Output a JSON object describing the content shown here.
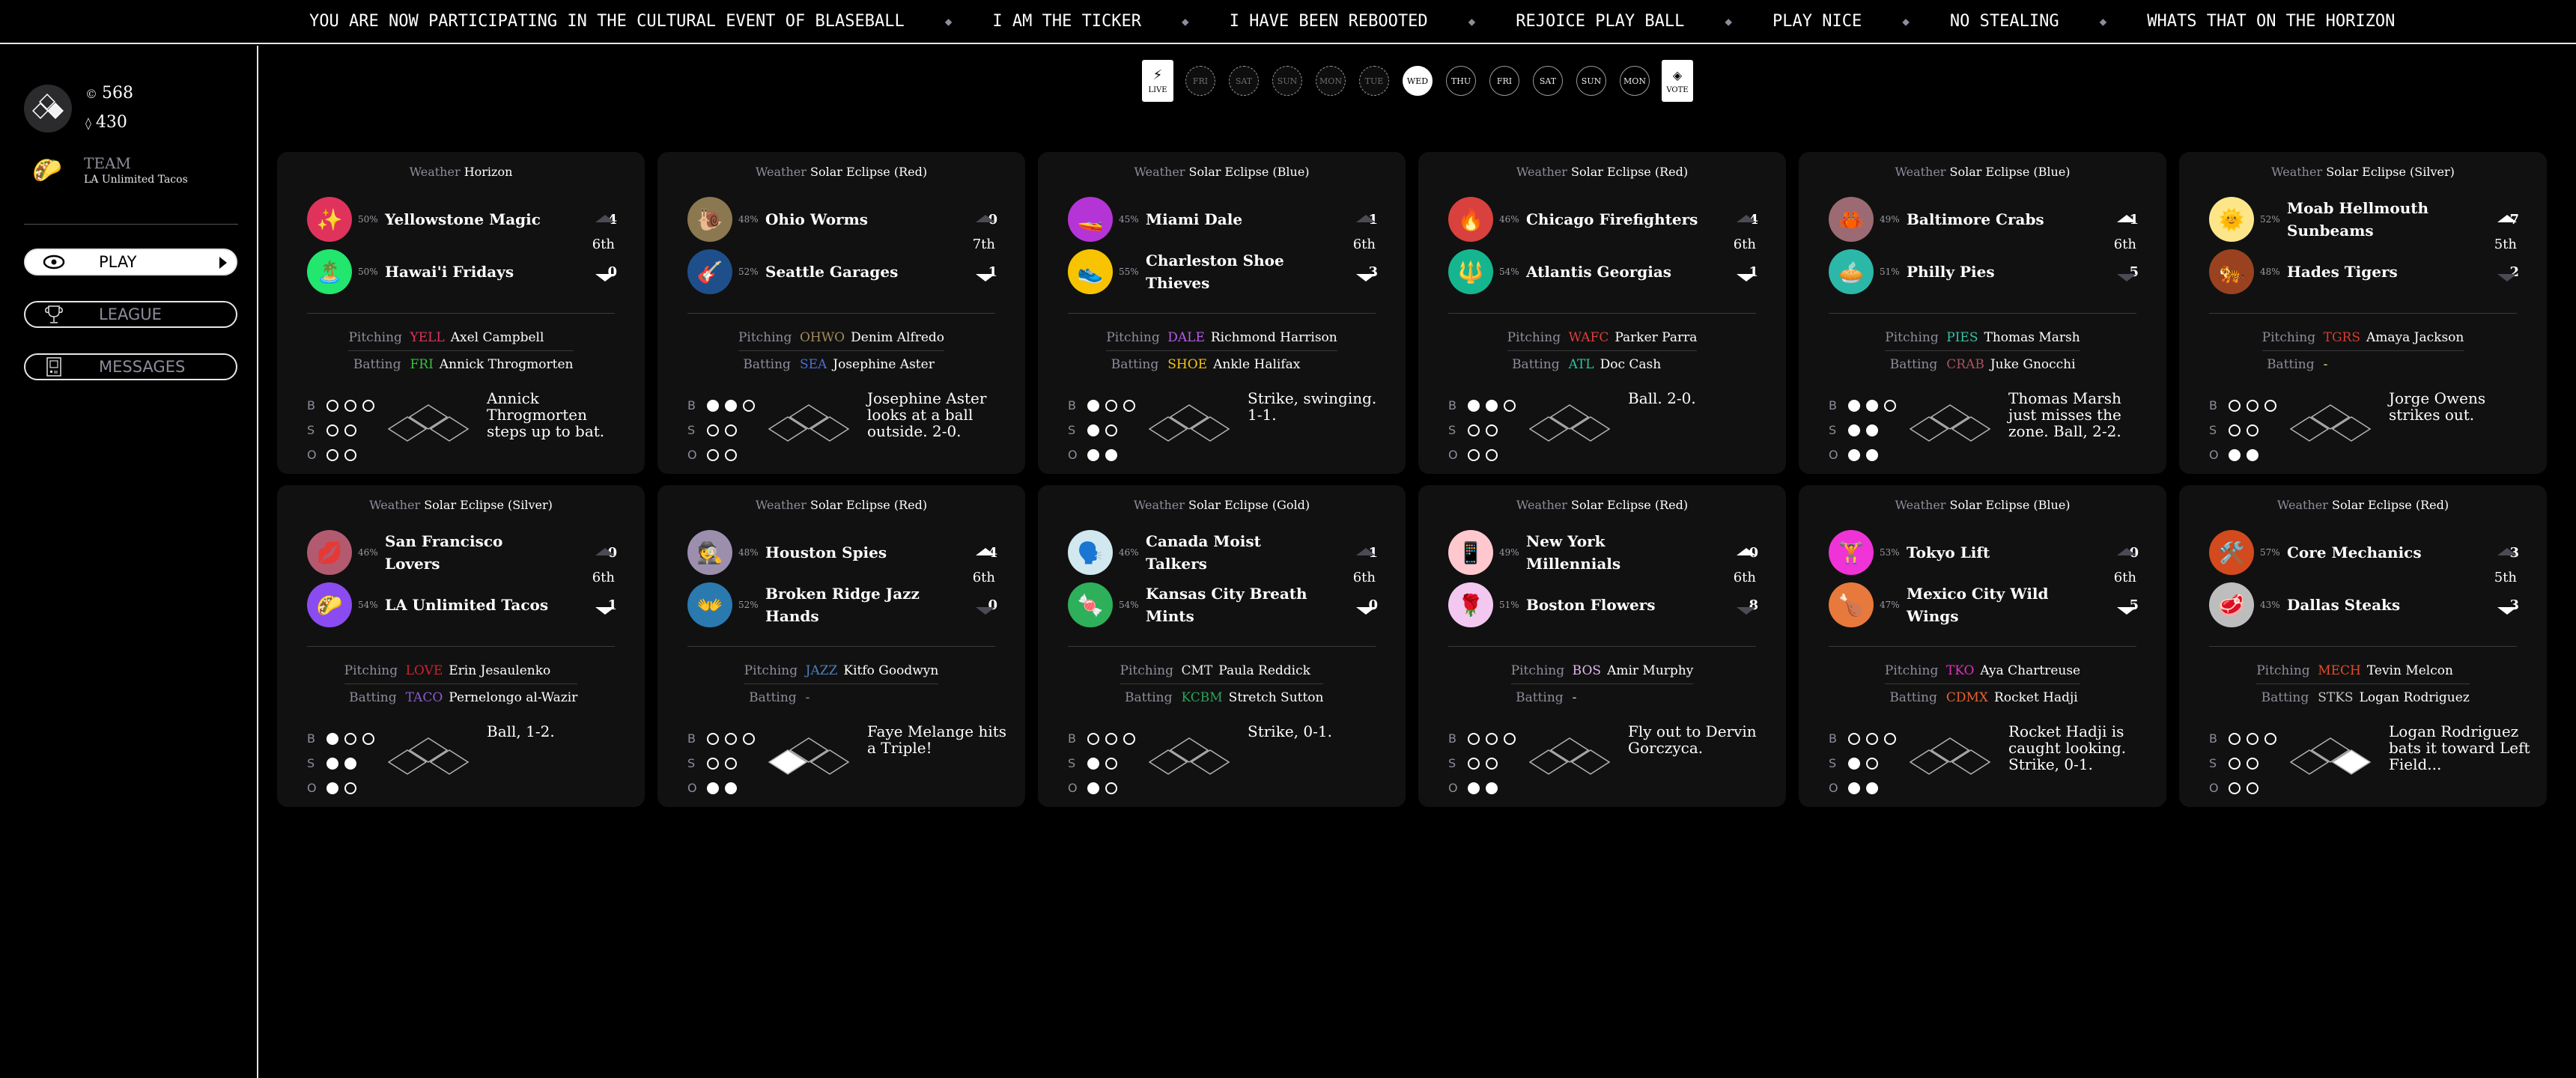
{
  "ticker": {
    "messages": [
      "YOU ARE NOW PARTICIPATING IN THE CULTURAL EVENT OF BLASEBALL",
      "I AM THE TICKER",
      "I HAVE BEEN REBOOTED",
      "REJOICE PLAY BALL",
      "PLAY NICE",
      "NO STEALING",
      "WHATS THAT ON THE HORIZON"
    ],
    "separator_icon": "diamond-icon"
  },
  "sidebar": {
    "coins": "568",
    "votes": "430",
    "coin_icon": "coin-icon",
    "vote_icon": "diamond-vote-icon",
    "team_label": "TEAM",
    "team_name": "LA Unlimited Tacos",
    "team_emoji": "🌮",
    "nav": [
      {
        "label": "PLAY",
        "icon": "eye-icon",
        "active": true
      },
      {
        "label": "LEAGUE",
        "icon": "trophy-icon",
        "active": false
      },
      {
        "label": "MESSAGES",
        "icon": "messages-icon",
        "active": false
      }
    ]
  },
  "day_selector": {
    "live_label": "LIVE",
    "vote_label": "VOTE",
    "days": [
      {
        "label": "FRI",
        "state": "past"
      },
      {
        "label": "SAT",
        "state": "past"
      },
      {
        "label": "SUN",
        "state": "past"
      },
      {
        "label": "MON",
        "state": "past"
      },
      {
        "label": "TUE",
        "state": "past"
      },
      {
        "label": "WED",
        "state": "current"
      },
      {
        "label": "THU",
        "state": "future"
      },
      {
        "label": "FRI",
        "state": "future"
      },
      {
        "label": "SAT",
        "state": "future"
      },
      {
        "label": "SUN",
        "state": "future"
      },
      {
        "label": "MON",
        "state": "future"
      }
    ]
  },
  "labels": {
    "weather": "Weather",
    "pitching": "Pitching",
    "batting": "Batting"
  },
  "games": [
    {
      "weather": "Horizon",
      "inning": "6th",
      "top_of_inning": false,
      "away": {
        "name": "Yellowstone Magic",
        "pct": "50%",
        "score": "4",
        "emoji": "✨",
        "color": "#e0335c"
      },
      "home": {
        "name": "Hawai'i Fridays",
        "pct": "50%",
        "score": "0",
        "emoji": "🏝️",
        "color": "#22e66d"
      },
      "pitching": {
        "abbr": "YELL",
        "abbr_color": "#e0335c",
        "name": "Axel Campbell"
      },
      "batting": {
        "abbr": "FRI",
        "abbr_color": "#35c43e",
        "name": "Annick Throgmorten"
      },
      "balls": 0,
      "strikes": 0,
      "outs": 0,
      "bases": [
        false,
        false,
        false
      ],
      "update": "Annick Throgmorten steps up to bat."
    },
    {
      "weather": "Solar Eclipse (Red)",
      "inning": "7th",
      "top_of_inning": false,
      "away": {
        "name": "Ohio Worms",
        "pct": "48%",
        "score": "0",
        "emoji": "🐌",
        "color": "#8b7850"
      },
      "home": {
        "name": "Seattle Garages",
        "pct": "52%",
        "score": "1",
        "emoji": "🎸",
        "color": "#1f4f8b"
      },
      "pitching": {
        "abbr": "OHWO",
        "abbr_color": "#a08a5a",
        "name": "Denim Alfredo"
      },
      "batting": {
        "abbr": "SEA",
        "abbr_color": "#4d6fd6",
        "name": "Josephine Aster"
      },
      "balls": 2,
      "strikes": 0,
      "outs": 0,
      "bases": [
        false,
        false,
        false
      ],
      "update": "Josephine Aster looks at a ball outside. 2-0."
    },
    {
      "weather": "Solar Eclipse (Blue)",
      "inning": "6th",
      "top_of_inning": false,
      "away": {
        "name": "Miami Dale",
        "pct": "45%",
        "score": "1",
        "emoji": "🚤",
        "color": "#b534d6"
      },
      "home": {
        "name": "Charleston Shoe Thieves",
        "pct": "55%",
        "score": "3",
        "emoji": "👟",
        "color": "#f8c300"
      },
      "pitching": {
        "abbr": "DALE",
        "abbr_color": "#b55be8",
        "name": "Richmond Harrison"
      },
      "batting": {
        "abbr": "SHOE",
        "abbr_color": "#f5c518",
        "name": "Ankle Halifax"
      },
      "balls": 1,
      "strikes": 1,
      "outs": 2,
      "bases": [
        false,
        false,
        false
      ],
      "update": "Strike, swinging. 1-1."
    },
    {
      "weather": "Solar Eclipse (Red)",
      "inning": "6th",
      "top_of_inning": false,
      "away": {
        "name": "Chicago Firefighters",
        "pct": "46%",
        "score": "4",
        "emoji": "🔥",
        "color": "#d8413d"
      },
      "home": {
        "name": "Atlantis Georgias",
        "pct": "54%",
        "score": "1",
        "emoji": "🔱",
        "color": "#15b68f"
      },
      "pitching": {
        "abbr": "WAFC",
        "abbr_color": "#d8413d",
        "name": "Parker Parra"
      },
      "batting": {
        "abbr": "ATL",
        "abbr_color": "#2dc4a0",
        "name": "Doc Cash"
      },
      "balls": 2,
      "strikes": 0,
      "outs": 0,
      "bases": [
        false,
        false,
        false
      ],
      "update": "Ball. 2-0."
    },
    {
      "weather": "Solar Eclipse (Blue)",
      "inning": "6th",
      "top_of_inning": true,
      "away": {
        "name": "Baltimore Crabs",
        "pct": "49%",
        "score": "1",
        "emoji": "🦀",
        "color": "#9b6a72"
      },
      "home": {
        "name": "Philly Pies",
        "pct": "51%",
        "score": "5",
        "emoji": "🥧",
        "color": "#2cb8a8"
      },
      "pitching": {
        "abbr": "PIES",
        "abbr_color": "#39c2a6",
        "name": "Thomas Marsh"
      },
      "batting": {
        "abbr": "CRAB",
        "abbr_color": "#a8535f",
        "name": "Juke Gnocchi"
      },
      "balls": 2,
      "strikes": 2,
      "outs": 2,
      "bases": [
        false,
        false,
        false
      ],
      "update": "Thomas Marsh just misses the zone. Ball, 2-2."
    },
    {
      "weather": "Solar Eclipse (Silver)",
      "inning": "5th",
      "top_of_inning": true,
      "away": {
        "name": "Moab Hellmouth Sunbeams",
        "pct": "52%",
        "score": "7",
        "emoji": "🌞",
        "color": "#fde68a"
      },
      "home": {
        "name": "Hades Tigers",
        "pct": "48%",
        "score": "2",
        "emoji": "🐅",
        "color": "#9a4220"
      },
      "pitching": {
        "abbr": "TGRS",
        "abbr_color": "#d83b32",
        "name": "Amaya Jackson"
      },
      "batting": {
        "abbr": "-",
        "abbr_color": "#f5e28a",
        "name": ""
      },
      "balls": 0,
      "strikes": 0,
      "outs": 2,
      "bases": [
        false,
        false,
        false
      ],
      "update": "Jorge Owens strikes out."
    },
    {
      "weather": "Solar Eclipse (Silver)",
      "inning": "6th",
      "top_of_inning": false,
      "away": {
        "name": "San Francisco Lovers",
        "pct": "46%",
        "score": "0",
        "emoji": "💋",
        "color": "#b25a70"
      },
      "home": {
        "name": "LA Unlimited Tacos",
        "pct": "54%",
        "score": "1",
        "emoji": "🌮",
        "color": "#8a4cf0"
      },
      "pitching": {
        "abbr": "LOVE",
        "abbr_color": "#d1202f",
        "name": "Erin Jesaulenko"
      },
      "batting": {
        "abbr": "TACO",
        "abbr_color": "#8a5cc8",
        "name": "Pernelongo al-Wazir"
      },
      "balls": 1,
      "strikes": 2,
      "outs": 1,
      "bases": [
        false,
        false,
        false
      ],
      "update": "Ball, 1-2."
    },
    {
      "weather": "Solar Eclipse (Red)",
      "inning": "6th",
      "top_of_inning": true,
      "away": {
        "name": "Houston Spies",
        "pct": "48%",
        "score": "4",
        "emoji": "🕵️",
        "color": "#9c8fae"
      },
      "home": {
        "name": "Broken Ridge Jazz Hands",
        "pct": "52%",
        "score": "0",
        "emoji": "👐",
        "color": "#2a7ab0"
      },
      "pitching": {
        "abbr": "JAZZ",
        "abbr_color": "#4c7fc4",
        "name": "Kitfo Goodwyn"
      },
      "batting": {
        "abbr": "-",
        "abbr_color": "#9a9aa5",
        "name": ""
      },
      "balls": 0,
      "strikes": 0,
      "outs": 2,
      "bases": [
        false,
        false,
        true
      ],
      "update": "Faye Melange hits a Triple!"
    },
    {
      "weather": "Solar Eclipse (Gold)",
      "inning": "6th",
      "top_of_inning": false,
      "away": {
        "name": "Canada Moist Talkers",
        "pct": "46%",
        "score": "1",
        "emoji": "🗣️",
        "color": "#d1e8f0"
      },
      "home": {
        "name": "Kansas City Breath Mints",
        "pct": "54%",
        "score": "0",
        "emoji": "🍬",
        "color": "#2eaf5a"
      },
      "pitching": {
        "abbr": "CMT",
        "abbr_color": "#e6e6e6",
        "name": "Paula Reddick"
      },
      "batting": {
        "abbr": "KCBM",
        "abbr_color": "#2ea25a",
        "name": "Stretch Sutton"
      },
      "balls": 0,
      "strikes": 1,
      "outs": 1,
      "bases": [
        false,
        false,
        false
      ],
      "update": "Strike, 0-1."
    },
    {
      "weather": "Solar Eclipse (Red)",
      "inning": "6th",
      "top_of_inning": true,
      "away": {
        "name": "New York Millennials",
        "pct": "49%",
        "score": "0",
        "emoji": "📱",
        "color": "#ffc8cf"
      },
      "home": {
        "name": "Boston Flowers",
        "pct": "51%",
        "score": "8",
        "emoji": "🌹",
        "color": "#f2c8f0"
      },
      "pitching": {
        "abbr": "BOS",
        "abbr_color": "#e3b8f0",
        "name": "Amir Murphy"
      },
      "batting": {
        "abbr": "-",
        "abbr_color": "#ffc8cf",
        "name": ""
      },
      "balls": 0,
      "strikes": 0,
      "outs": 2,
      "bases": [
        false,
        false,
        false
      ],
      "update": "Fly out to Dervin Gorczyca."
    },
    {
      "weather": "Solar Eclipse (Blue)",
      "inning": "6th",
      "top_of_inning": false,
      "away": {
        "name": "Tokyo Lift",
        "pct": "53%",
        "score": "0",
        "emoji": "🏋️",
        "color": "#f033d6"
      },
      "home": {
        "name": "Mexico City Wild Wings",
        "pct": "47%",
        "score": "5",
        "emoji": "🍗",
        "color": "#e8793c"
      },
      "pitching": {
        "abbr": "TKO",
        "abbr_color": "#e030b8",
        "name": "Aya Chartreuse"
      },
      "batting": {
        "abbr": "CDMX",
        "abbr_color": "#e8612e",
        "name": "Rocket Hadji"
      },
      "balls": 0,
      "strikes": 1,
      "outs": 2,
      "bases": [
        false,
        false,
        false
      ],
      "update": "Rocket Hadji is caught looking. Strike, 0-1."
    },
    {
      "weather": "Solar Eclipse (Red)",
      "inning": "5th",
      "top_of_inning": false,
      "away": {
        "name": "Core Mechanics",
        "pct": "57%",
        "score": "3",
        "emoji": "🛠️",
        "color": "#d24a1e"
      },
      "home": {
        "name": "Dallas Steaks",
        "pct": "43%",
        "score": "3",
        "emoji": "🥩",
        "color": "#bdbdbd"
      },
      "pitching": {
        "abbr": "MECH",
        "abbr_color": "#e84a2a",
        "name": "Tevin Melcon"
      },
      "batting": {
        "abbr": "STKS",
        "abbr_color": "#c8c8c8",
        "name": "Logan Rodriguez"
      },
      "balls": 0,
      "strikes": 0,
      "outs": 0,
      "bases": [
        true,
        false,
        false
      ],
      "update": "Logan Rodriguez bats it toward Left Field..."
    }
  ]
}
